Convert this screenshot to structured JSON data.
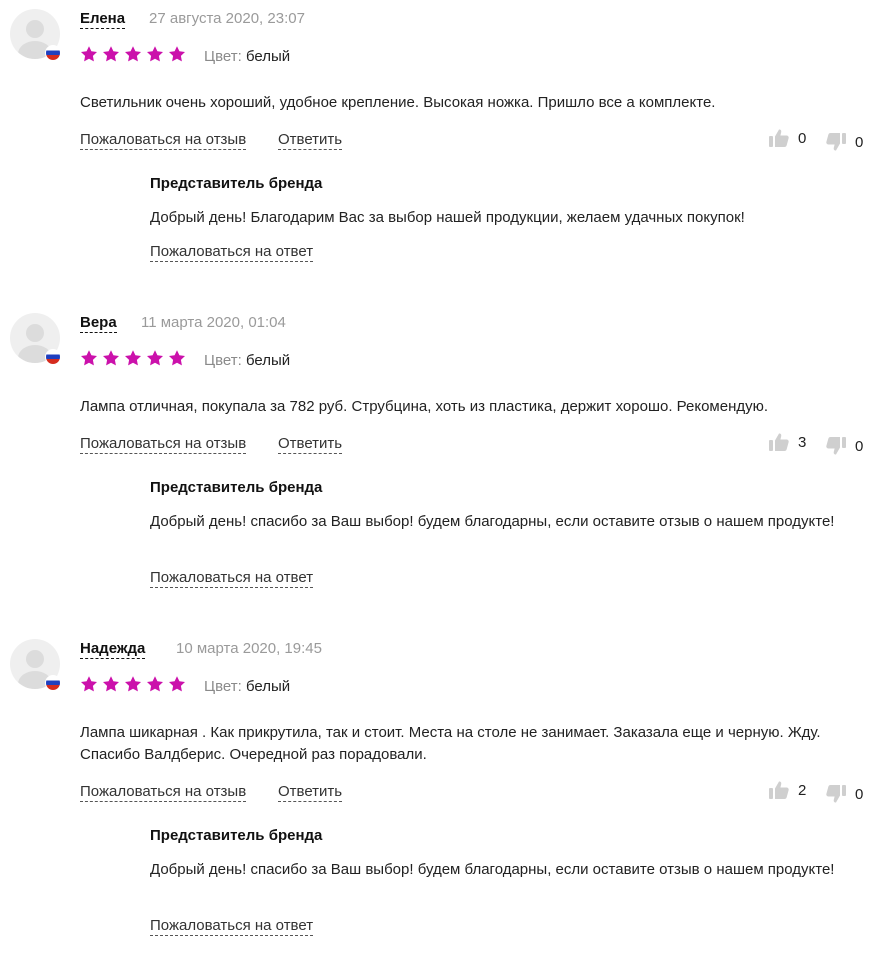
{
  "reviews": [
    {
      "author": "Елена",
      "date": "27 августа 2020, 23:07",
      "rating": 5,
      "color_label": "Цвет:",
      "color_value": "белый",
      "text": "Светильник очень хороший, удобное крепление. Высокая ножка. Пришло все а комплекте.",
      "complain_label": "Пожаловаться на отзыв",
      "reply_label": "Ответить",
      "likes": "0",
      "dislikes": "0",
      "brand_title": "Представитель бренда",
      "brand_text": "Добрый день! Благодарим Вас за выбор нашей продукции, желаем удачных покупок!",
      "brand_complain_label": "Пожаловаться на ответ"
    },
    {
      "author": "Вера",
      "date": "11 марта 2020, 01:04",
      "rating": 5,
      "color_label": "Цвет:",
      "color_value": "белый",
      "text": "Лампа отличная, покупала за 782 руб. Струбцина, хоть из пластика, держит хорошо. Рекомендую.",
      "complain_label": "Пожаловаться на отзыв",
      "reply_label": "Ответить",
      "likes": "3",
      "dislikes": "0",
      "brand_title": "Представитель бренда",
      "brand_text": "Добрый день! спасибо за Ваш выбор! будем благодарны, если оставите отзыв о нашем продукте!",
      "brand_complain_label": "Пожаловаться на ответ"
    },
    {
      "author": "Надежда",
      "date": "10 марта 2020, 19:45",
      "rating": 5,
      "color_label": "Цвет:",
      "color_value": "белый",
      "text": "Лампа шикарная . Как прикрутила, так и стоит. Места на столе не занимает. Заказала еще и черную. Жду. Спасибо Валдберис. Очередной раз порадовали.",
      "complain_label": "Пожаловаться на отзыв",
      "reply_label": "Ответить",
      "likes": "2",
      "dislikes": "0",
      "brand_title": "Представитель бренда",
      "brand_text": "Добрый день! спасибо за Ваш выбор! будем благодарны, если оставите отзыв о нашем продукте!",
      "brand_complain_label": "Пожаловаться на ответ"
    }
  ],
  "colors": {
    "star": "#cb11ab",
    "thumb": "#cfcfcf",
    "muted_text": "#9a9a9a"
  },
  "icons": {
    "avatar": "user-silhouette",
    "flag": "russia-flag",
    "star": "star-filled",
    "like": "thumbs-up-icon",
    "dislike": "thumbs-down-icon"
  }
}
